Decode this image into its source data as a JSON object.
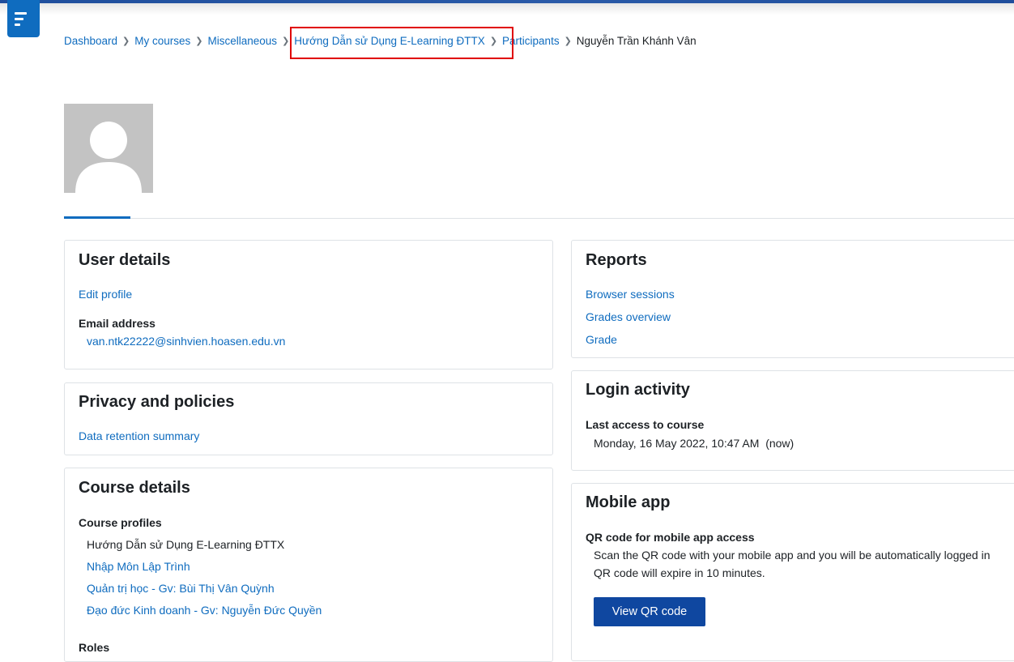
{
  "header": {
    "drawer_toggle_icon": "menu-icon"
  },
  "breadcrumb": [
    "Dashboard",
    "My courses",
    "Miscellaneous",
    "Hướng Dẫn sử Dụng E-Learning ĐTTX",
    "Participants",
    "Nguyễn Trần Khánh Vân"
  ],
  "breadcrumb_separator_icon": "chevron-right-icon",
  "profile": {
    "avatar_icon": "default-user-avatar-icon"
  },
  "user_details": {
    "title": "User details",
    "edit_profile": "Edit profile",
    "email_label": "Email address",
    "email_value": "van.ntk22222@sinhvien.hoasen.edu.vn"
  },
  "privacy": {
    "title": "Privacy and policies",
    "data_retention": "Data retention summary"
  },
  "course_details": {
    "title": "Course details",
    "profiles_label": "Course profiles",
    "courses": [
      "Hướng Dẫn sử Dụng E-Learning ĐTTX",
      "Nhập Môn Lập Trình",
      "Quản trị học - Gv: Bùi Thị Vân Quỳnh",
      "Đạo đức Kinh doanh - Gv: Nguyễn Đức Quyền"
    ],
    "roles_label": "Roles"
  },
  "reports": {
    "title": "Reports",
    "links": [
      "Browser sessions",
      "Grades overview",
      "Grade"
    ]
  },
  "login_activity": {
    "title": "Login activity",
    "last_access_label": "Last access to course",
    "last_access_value": "Monday, 16 May 2022, 10:47 AM  (now)"
  },
  "mobile_app": {
    "title": "Mobile app",
    "qr_label": "QR code for mobile app access",
    "line1": "Scan the QR code with your mobile app and you will be automatically logged in",
    "line2": "QR code will expire in 10 minutes.",
    "button": "View QR code"
  },
  "colors": {
    "link": "#0f6cbf",
    "highlight_box": "#e00000",
    "button": "#0f47a0"
  }
}
